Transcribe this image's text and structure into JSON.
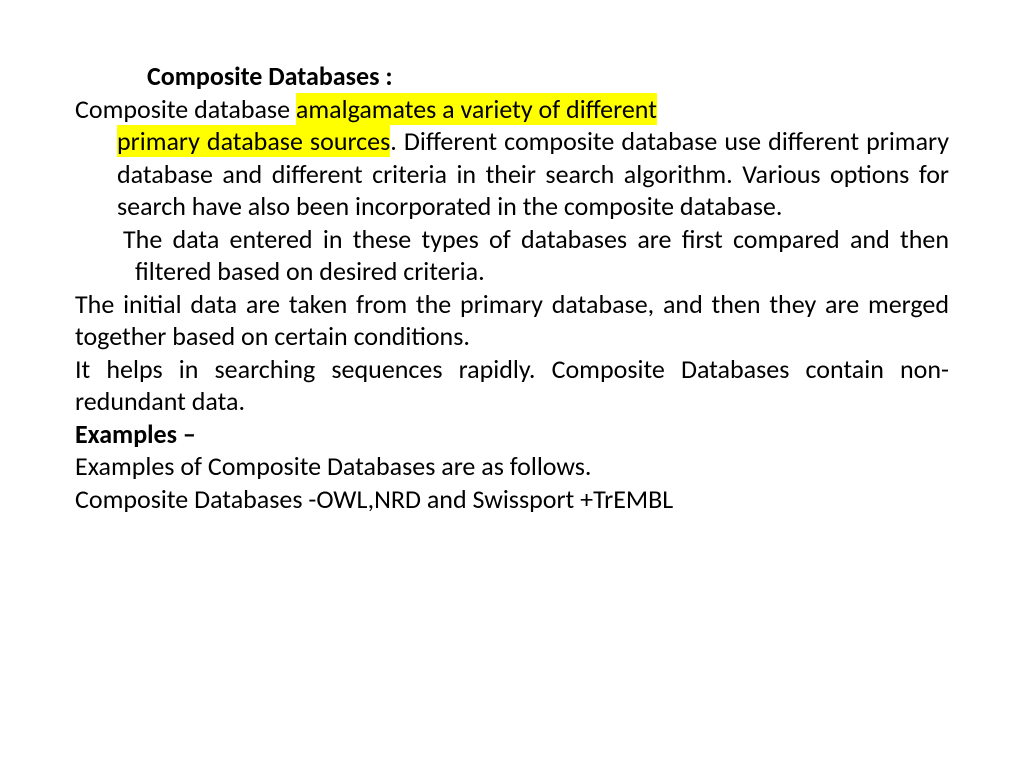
{
  "title": "Composite Databases :",
  "para1_lead": "Composite database ",
  "para1_hl1": "amalgamates a variety of different",
  "para1_hl2": "primary database sources",
  "para1_after": ". Different composite database use different primary database and different criteria in their search algorithm. Various options for search have also been incorporated in the composite database.",
  "para2": "The data entered in these types of databases are first compared and then",
  "para2b": "filtered based on desired criteria.",
  "para3": "The initial data are taken from the primary database, and then they are merged together based on certain conditions.",
  "para4": "It helps in searching sequences rapidly. Composite Databases contain non-redundant data.",
  "examples_label": "Examples –",
  "examples_text": "Examples of Composite Databases are as follows.",
  "examples_list": "Composite Databases -OWL,NRD and Swissport +TrEMBL"
}
